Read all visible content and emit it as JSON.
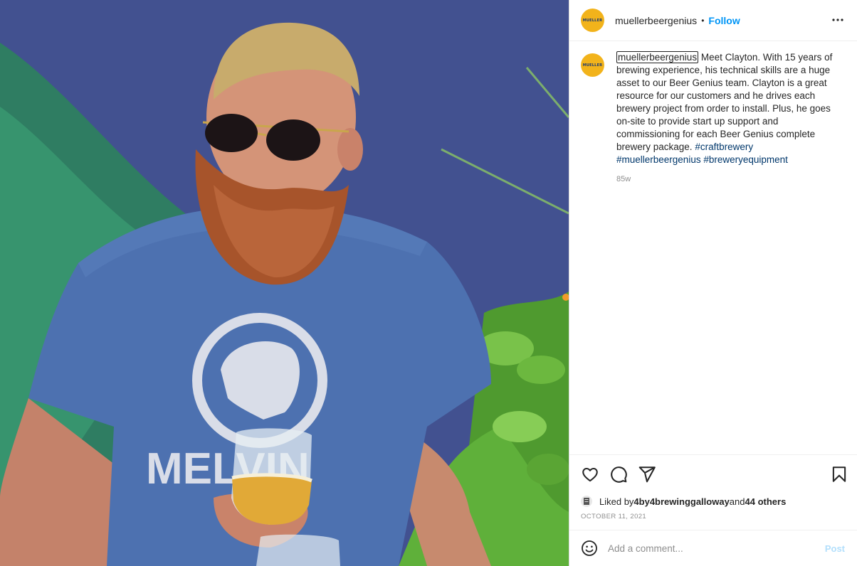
{
  "post": {
    "photo_alt": "",
    "shirt_text": "MELVIN"
  },
  "header": {
    "avatar_text": "MUELLER",
    "username": "muellerbeergenius",
    "separator": "•",
    "follow_label": "Follow",
    "more_icon": "more-horizontal-icon"
  },
  "caption": {
    "avatar_text": "MUELLER",
    "username": "muellerbeergenius",
    "text": " Meet Clayton. With 15 years of brewing experience, his technical skills are a huge asset to our Beer Genius team. Clayton is a great resource for our customers and he drives each brewery project from order to install. Plus, he goes on-site to provide start up support and commissioning for each Beer Genius complete brewery package. ",
    "hashtags": [
      "#craftbrewery",
      "#muellerbeergenius",
      "#breweryequipment"
    ],
    "time": "85w"
  },
  "actions": {
    "like_icon": "heart-icon",
    "comment_icon": "comment-icon",
    "share_icon": "paper-plane-icon",
    "save_icon": "bookmark-icon"
  },
  "likes": {
    "prefix": "Liked by ",
    "user": "4by4brewinggalloway",
    "middle": " and ",
    "others": "44 others"
  },
  "date": "OCTOBER 11, 2021",
  "comment_box": {
    "placeholder": "Add a comment...",
    "post_label": "Post",
    "emoji_icon": "smiley-icon"
  },
  "colors": {
    "accent": "#0095f6",
    "hashtag": "#00376b",
    "avatar_bg": "#f2b31b",
    "muted": "#8e8e8e",
    "post_disabled": "#b2dffc"
  }
}
